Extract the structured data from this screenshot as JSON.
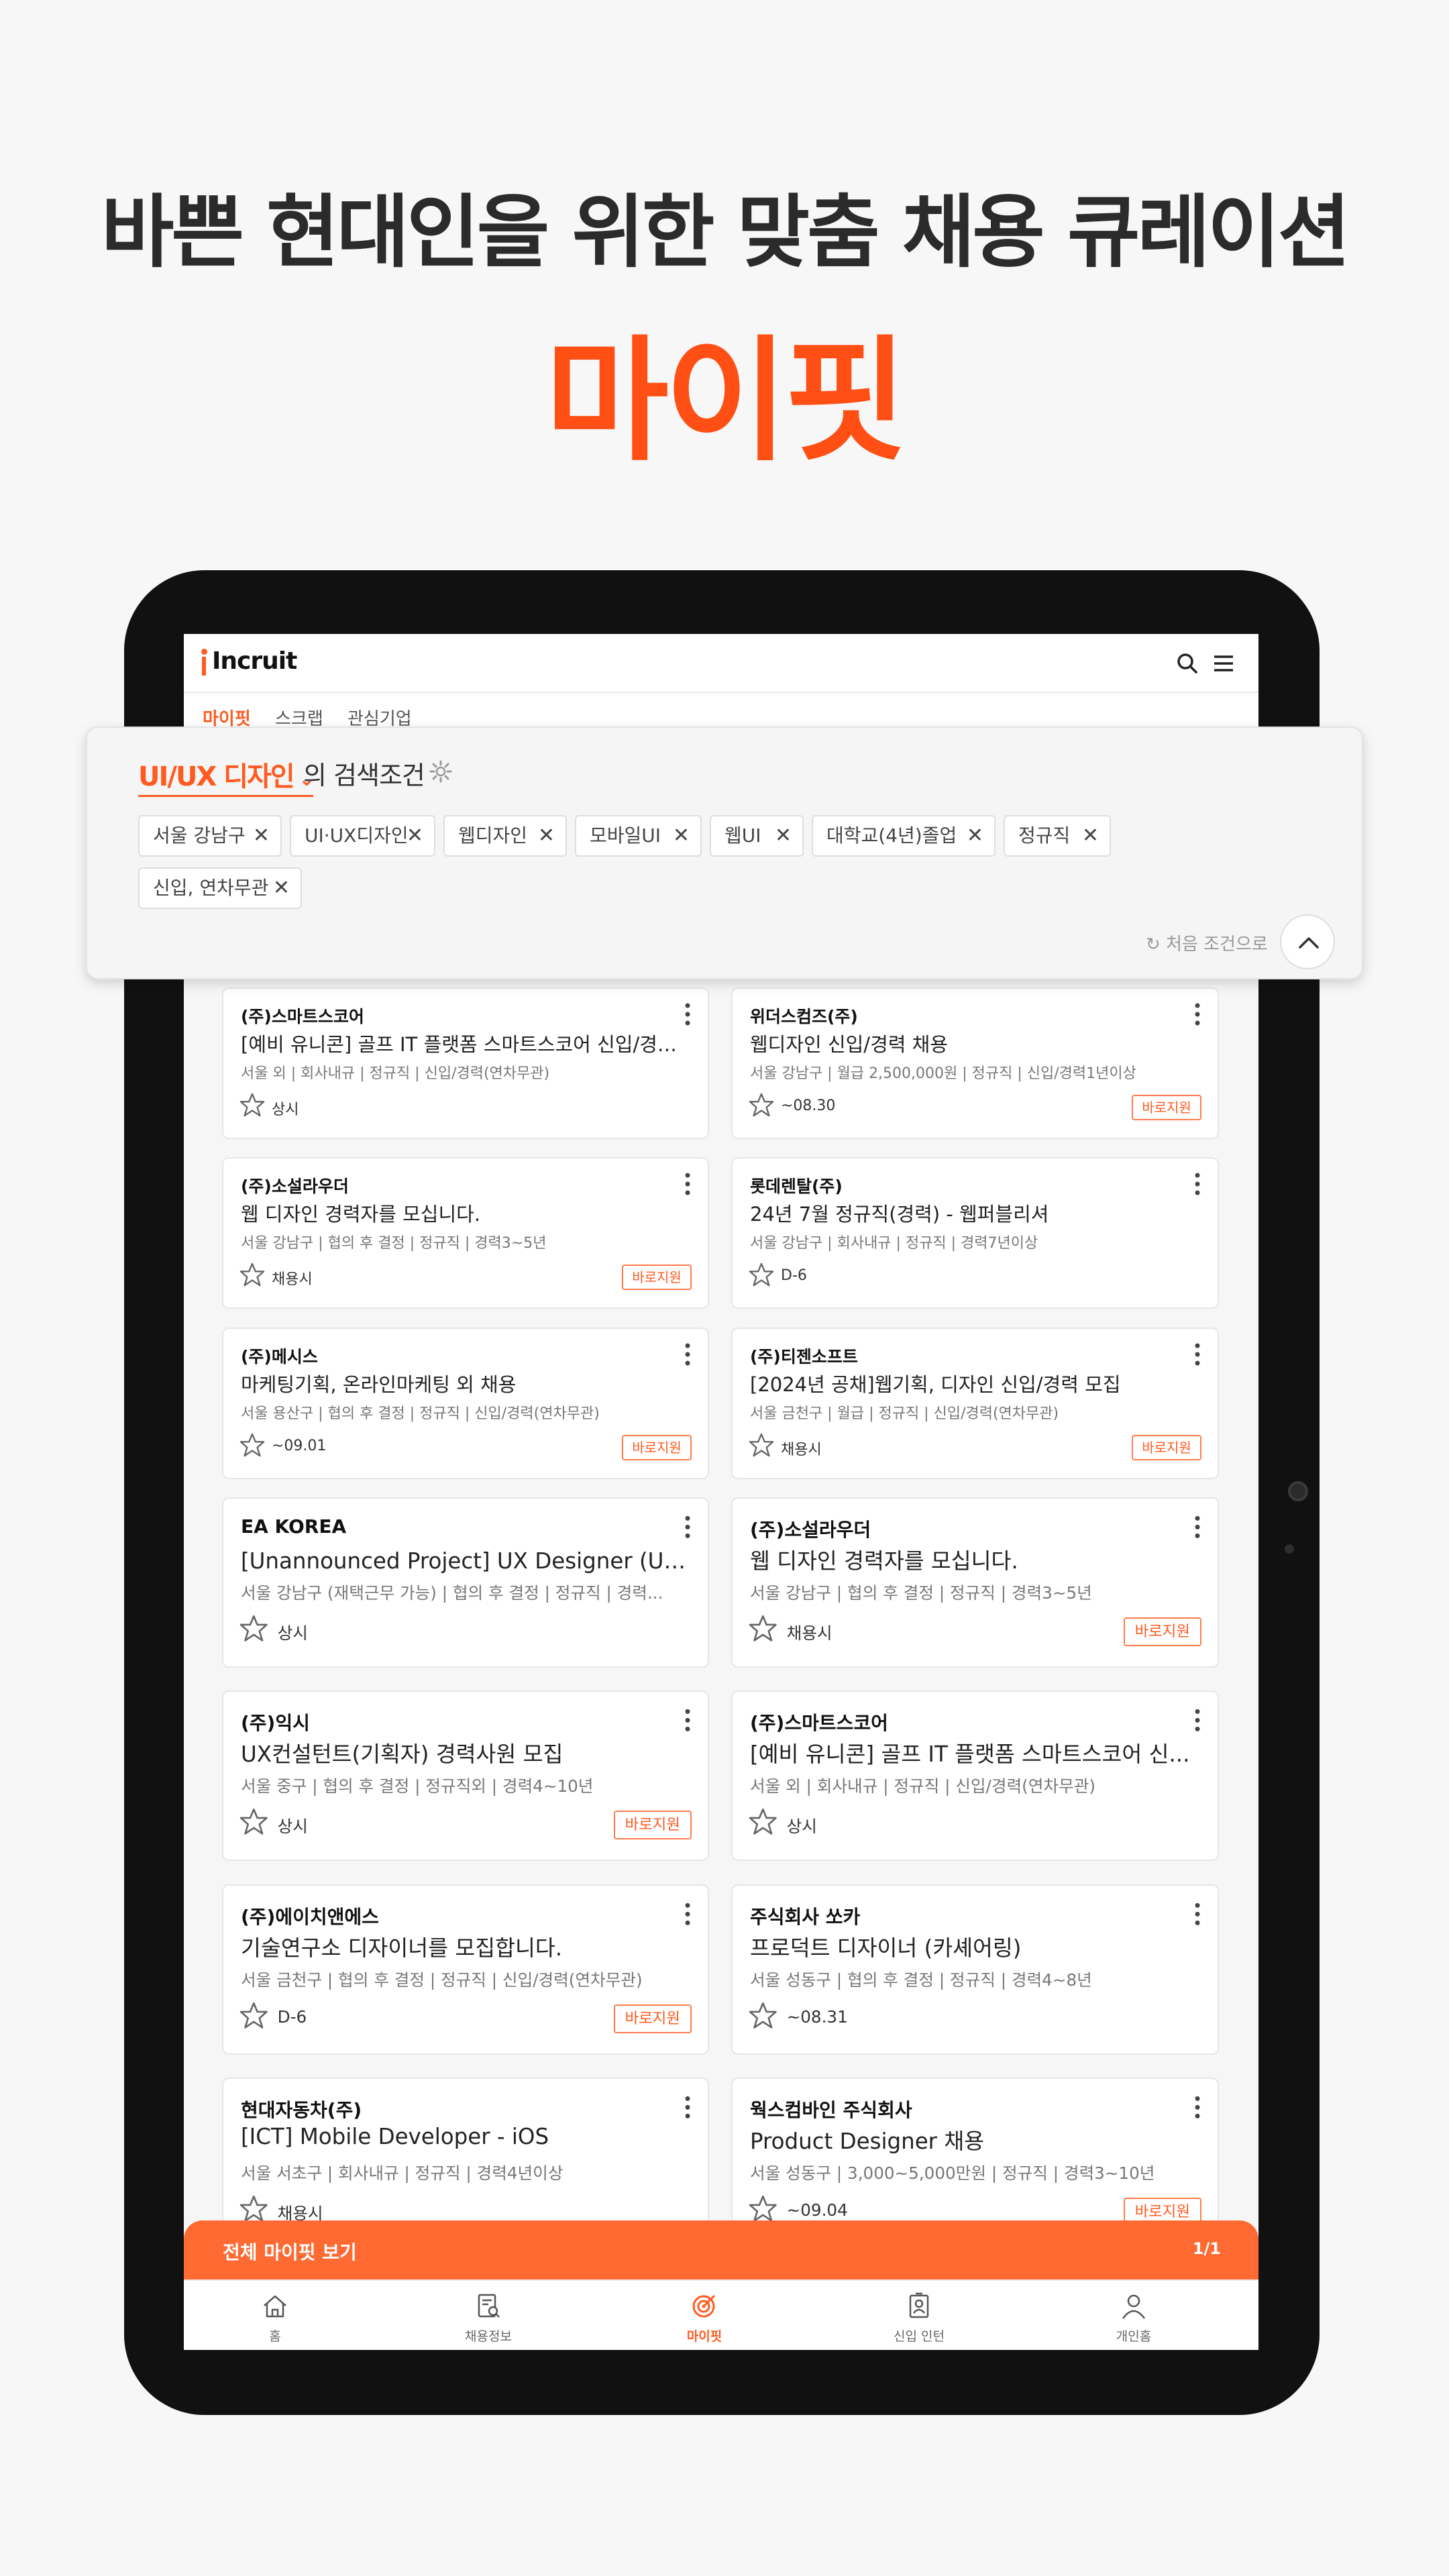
{
  "promo": {
    "headline": "바쁜 현대인을 위한 맞춤 채용 큐레이션",
    "brand": "마이핏"
  },
  "app": {
    "logo": "Incruit",
    "subtabs": [
      "마이핏",
      "스크랩",
      "관심기업"
    ],
    "accent": "#ff5a1f"
  },
  "search_panel": {
    "keyword": "UI/UX 디자인",
    "suffix": "의 검색조건",
    "chips": [
      "서울 강남구",
      "UI·UX디자인",
      "웹디자인",
      "모바일UI",
      "웹UI",
      "대학교(4년)졸업",
      "정규직",
      "신입, 연차무관"
    ],
    "reset_label": "처음 조건으로"
  },
  "jobs": [
    {
      "company": "(주)스마트스코어",
      "title": "[예비 유니콘] 골프 IT 플랫폼 스마트스코어 신입/경력 ...",
      "meta": "서울 외 | 회사내규 | 정규직 | 신입/경력(연차무관)",
      "due": "상시",
      "apply": ""
    },
    {
      "company": "위더스컴즈(주)",
      "title": "웹디자인 신입/경력 채용",
      "meta": "서울 강남구 | 월급 2,500,000원 | 정규직 | 신입/경력1년이상",
      "due": "~08.30",
      "apply": "바로지원"
    },
    {
      "company": "(주)소설라우더",
      "title": "웹 디자인 경력자를 모십니다.",
      "meta": "서울 강남구 | 협의 후 결정 | 정규직 | 경력3~5년",
      "due": "채용시",
      "apply": "바로지원"
    },
    {
      "company": "롯데렌탈(주)",
      "title": "24년 7월 정규직(경력) - 웹퍼블리셔",
      "meta": "서울 강남구 | 회사내규 | 정규직 | 경력7년이상",
      "due": "D-6",
      "apply": ""
    },
    {
      "company": "(주)메시스",
      "title": "마케팅기획, 온라인마케팅 외 채용",
      "meta": "서울 용산구 | 협의 후 결정 | 정규직 | 신입/경력(연차무관)",
      "due": "~09.01",
      "apply": "바로지원"
    },
    {
      "company": "(주)티젠소프트",
      "title": "[2024년 공채]웹기획, 디자인 신입/경력 모집",
      "meta": "서울 금천구 | 월급 | 정규직 | 신입/경력(연차무관)",
      "due": "채용시",
      "apply": "바로지원"
    },
    {
      "company": "EA KOREA",
      "title": "[Unannounced Project] UX Designer (UX 기획자) ...",
      "meta": "서울 강남구 (재택근무 가능) | 협의 후 결정 | 정규직 | 경력...",
      "due": "상시",
      "apply": ""
    },
    {
      "company": "(주)소설라우더",
      "title": "웹 디자인 경력자를 모십니다.",
      "meta": "서울 강남구 | 협의 후 결정 | 정규직 | 경력3~5년",
      "due": "채용시",
      "apply": "바로지원"
    },
    {
      "company": "(주)익시",
      "title": "UX컨설턴트(기획자) 경력사원 모집",
      "meta": "서울 중구 | 협의 후 결정 | 정규직외 | 경력4~10년",
      "due": "상시",
      "apply": "바로지원"
    },
    {
      "company": "(주)스마트스코어",
      "title": "[예비 유니콘] 골프 IT 플랫폼 스마트스코어 신...",
      "meta": "서울 외 | 회사내규 | 정규직 | 신입/경력(연차무관)",
      "due": "상시",
      "apply": ""
    },
    {
      "company": "(주)에이치앤에스",
      "title": "기술연구소 디자이너를 모집합니다.",
      "meta": "서울 금천구 | 협의 후 결정 | 정규직 | 신입/경력(연차무관)",
      "due": "D-6",
      "apply": "바로지원"
    },
    {
      "company": "주식회사 쏘카",
      "title": "프로덕트 디자이너 (카셰어링)",
      "meta": "서울 성동구 | 협의 후 결정 | 정규직 | 경력4~8년",
      "due": "~08.31",
      "apply": ""
    },
    {
      "company": "현대자동차(주)",
      "title": "[ICT] Mobile Developer - iOS",
      "meta": "서울 서초구 | 회사내규 | 정규직 | 경력4년이상",
      "due": "채용시",
      "apply": ""
    },
    {
      "company": "웍스컴바인 주식회사",
      "title": "Product Designer 채용",
      "meta": "서울 성동구 | 3,000~5,000만원 | 정규직 | 경력3~10년",
      "due": "~09.04",
      "apply": "바로지원"
    }
  ],
  "bottom_strip": {
    "label": "전체 마이핏 보기",
    "count": "1/1"
  },
  "nav": [
    {
      "label": "홈",
      "icon": "home-icon"
    },
    {
      "label": "채용정보",
      "icon": "job-search-icon"
    },
    {
      "label": "마이핏",
      "icon": "myfit-target-icon",
      "active": true
    },
    {
      "label": "신입 인턴",
      "icon": "id-badge-icon"
    },
    {
      "label": "개인홈",
      "icon": "person-icon"
    }
  ]
}
